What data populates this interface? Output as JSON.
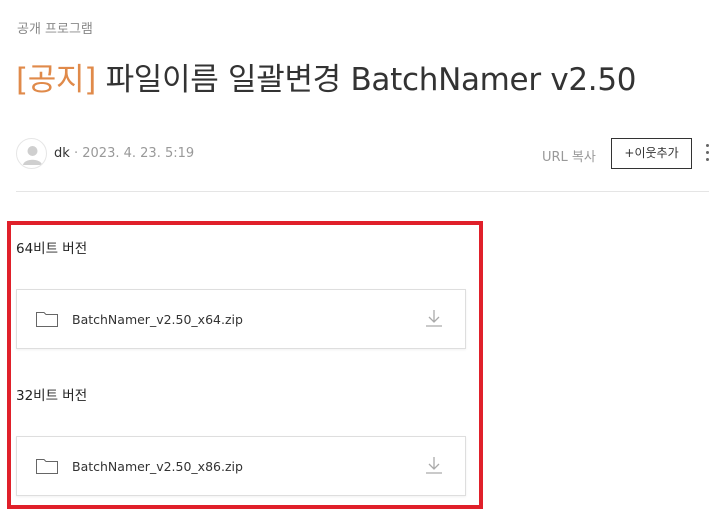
{
  "category": "공개 프로그램",
  "title": {
    "prefix": "[공지]",
    "text": " 파일이름 일괄변경 BatchNamer v2.50"
  },
  "meta": {
    "author": "dk",
    "date": "· 2023. 4. 23. 5:19",
    "url_copy": "URL 복사",
    "add_neighbor": "+이웃추가"
  },
  "attachments": [
    {
      "section": "64비트 버전",
      "filename": "BatchNamer_v2.50_x64.zip"
    },
    {
      "section": "32비트 버전",
      "filename": "BatchNamer_v2.50_x86.zip"
    }
  ],
  "colors": {
    "title_prefix": "#e08a4a",
    "highlight_border": "#e0202a"
  },
  "icons": [
    "user-avatar-icon",
    "more-options-icon",
    "folder-icon",
    "download-icon"
  ]
}
